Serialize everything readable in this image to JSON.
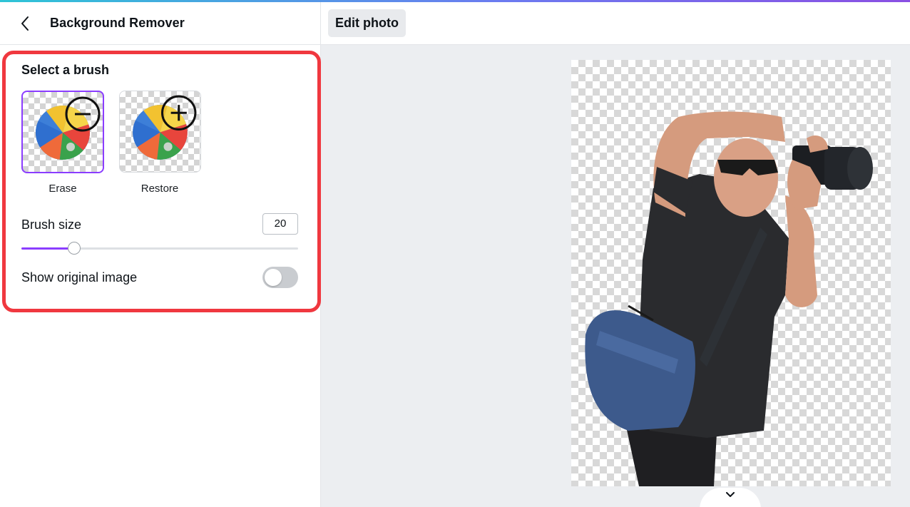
{
  "panel": {
    "title": "Background Remover",
    "select_brush_heading": "Select a brush",
    "brushes": [
      {
        "label": "Erase",
        "icon": "minus-circle-icon",
        "selected": true
      },
      {
        "label": "Restore",
        "icon": "plus-circle-icon",
        "selected": false
      }
    ],
    "brush_size_label": "Brush size",
    "brush_size_value": "20",
    "brush_size_slider_fraction": 0.19,
    "show_original_label": "Show original image",
    "show_original_on": false
  },
  "toolbar": {
    "edit_photo_label": "Edit photo"
  },
  "colors": {
    "accent": "#8b3dff",
    "highlight_border": "#f0383f"
  }
}
